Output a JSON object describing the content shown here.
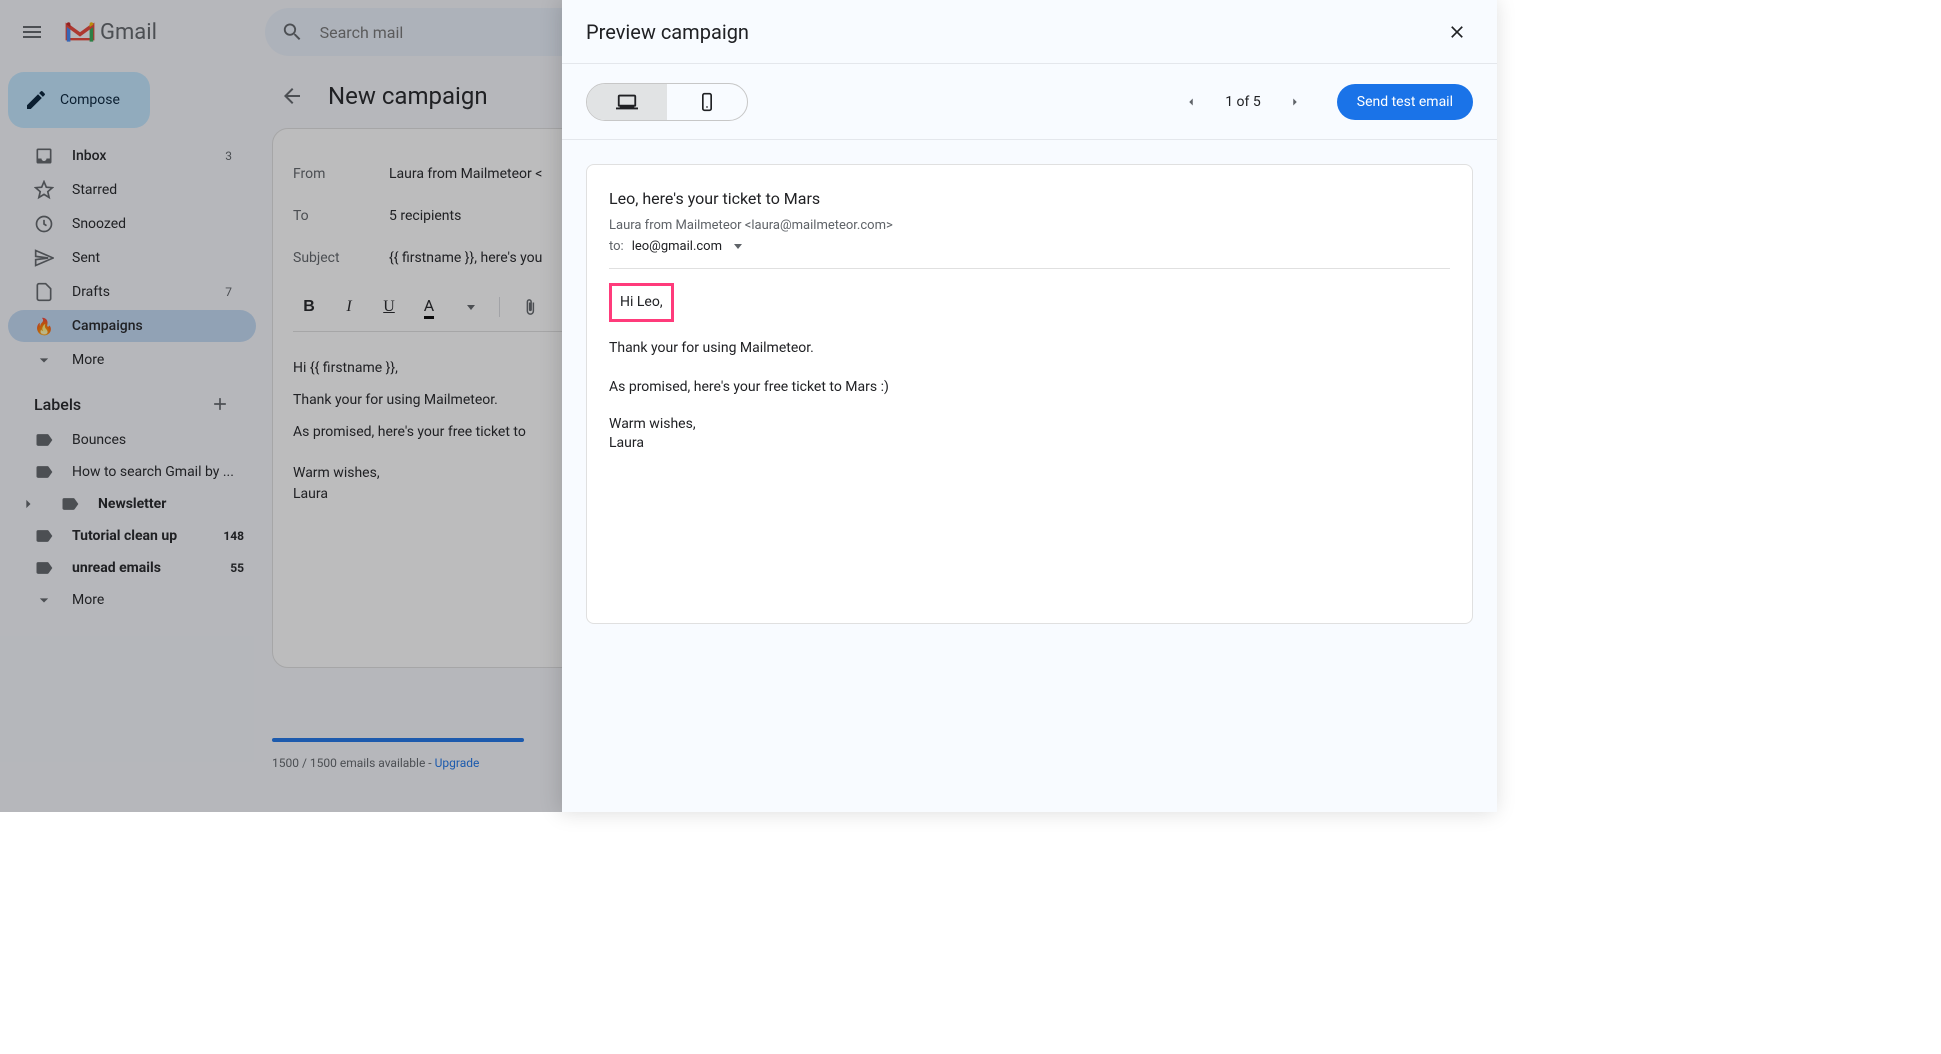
{
  "header": {
    "gmail_text": "Gmail",
    "search_placeholder": "Search mail"
  },
  "sidebar": {
    "compose_label": "Compose",
    "items": [
      {
        "label": "Inbox",
        "count": "3"
      },
      {
        "label": "Starred",
        "count": ""
      },
      {
        "label": "Snoozed",
        "count": ""
      },
      {
        "label": "Sent",
        "count": ""
      },
      {
        "label": "Drafts",
        "count": "7"
      },
      {
        "label": "Campaigns",
        "count": ""
      },
      {
        "label": "More",
        "count": ""
      }
    ],
    "labels_header": "Labels",
    "labels": [
      {
        "label": "Bounces",
        "count": ""
      },
      {
        "label": "How to search Gmail by ...",
        "count": ""
      },
      {
        "label": "Newsletter",
        "count": ""
      },
      {
        "label": "Tutorial clean up",
        "count": "148"
      },
      {
        "label": "unread emails",
        "count": "55"
      },
      {
        "label": "More",
        "count": ""
      }
    ]
  },
  "main": {
    "title": "New campaign",
    "from_label": "From",
    "from_value": "Laura from Mailmeteor <",
    "to_label": "To",
    "to_value": "5 recipients",
    "subject_label": "Subject",
    "subject_value": "{{ firstname }}, here's you",
    "editor_lines": {
      "l1": "Hi {{ firstname }},",
      "l2": "Thank your for using Mailmeteor.",
      "l3": "As promised, here's your free ticket to",
      "l4": "Warm wishes,",
      "l5": "Laura"
    },
    "quota_text": "1500 / 1500 emails available - ",
    "upgrade_text": "Upgrade"
  },
  "panel": {
    "title": "Preview campaign",
    "page_indicator": "1 of 5",
    "send_test_label": "Send test email",
    "email": {
      "subject": "Leo, here's your ticket to Mars",
      "from": "Laura from Mailmeteor <laura@mailmeteor.com>",
      "to_label": "to:",
      "to_value": "leo@gmail.com",
      "greeting": "Hi Leo,",
      "body1": "Thank your for using Mailmeteor.",
      "body2": "As promised, here's your free ticket to Mars :)",
      "signoff1": "Warm wishes,",
      "signoff2": "Laura"
    }
  }
}
